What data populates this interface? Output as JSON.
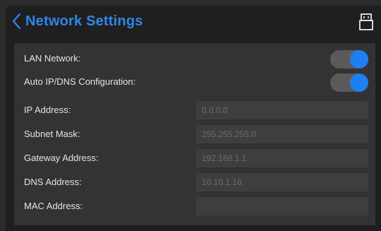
{
  "header": {
    "title": "Network Settings",
    "back_icon": "chevron-left-icon",
    "device_icon": "device-icon",
    "accent_color": "#2f86e8"
  },
  "settings": {
    "lan_network": {
      "label": "LAN Network:",
      "enabled": true
    },
    "auto_config": {
      "label": "Auto IP/DNS Configuration:",
      "enabled": true
    },
    "ip_address": {
      "label": "IP Address:",
      "value": "0.0.0.0"
    },
    "subnet_mask": {
      "label": "Subnet Mask:",
      "value": "255.255.255.0"
    },
    "gateway_address": {
      "label": "Gateway Address:",
      "value": "192.168.1.1"
    },
    "dns_address": {
      "label": "DNS Address:",
      "value": "10.10.1.18"
    },
    "mac_address": {
      "label": "MAC Address:",
      "value": ""
    }
  },
  "colors": {
    "toggle_on": "#1e7ff0",
    "panel": "#333333",
    "field": "#3e3e3e"
  }
}
